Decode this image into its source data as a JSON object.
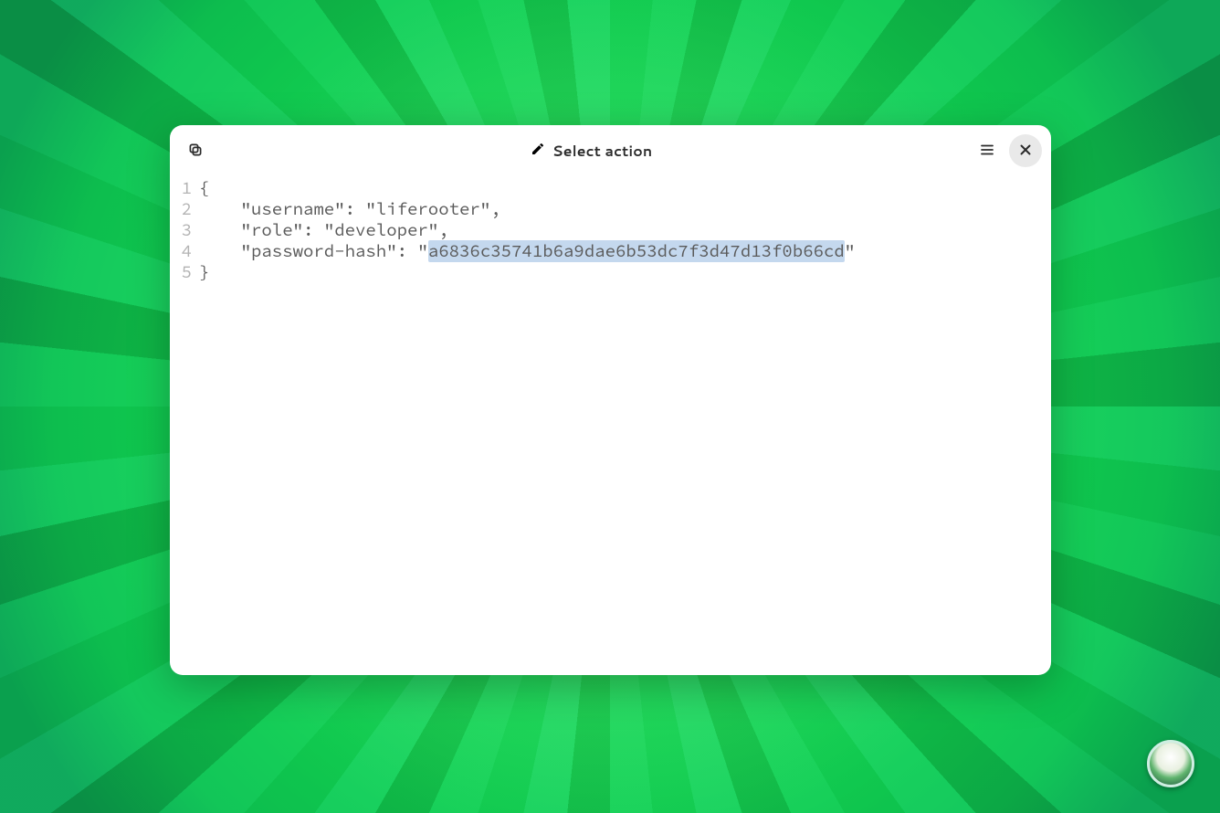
{
  "window": {
    "title": "Select action"
  },
  "editor": {
    "lines": {
      "n1": "1",
      "n2": "2",
      "n3": "3",
      "n4": "4",
      "n5": "5",
      "l1": "{",
      "l2": "    \"username\": \"liferooter\",",
      "l3": "    \"role\": \"developer\",",
      "l4_pre": "    \"password-hash\": \"",
      "l4_sel": "a6836c35741b6a9dae6b53dc7f3d47d13f0b66cd",
      "l4_post": "\"",
      "l5": "}"
    },
    "content": {
      "username": "liferooter",
      "role": "developer",
      "password_hash": "a6836c35741b6a9dae6b53dc7f3d47d13f0b66cd"
    }
  }
}
